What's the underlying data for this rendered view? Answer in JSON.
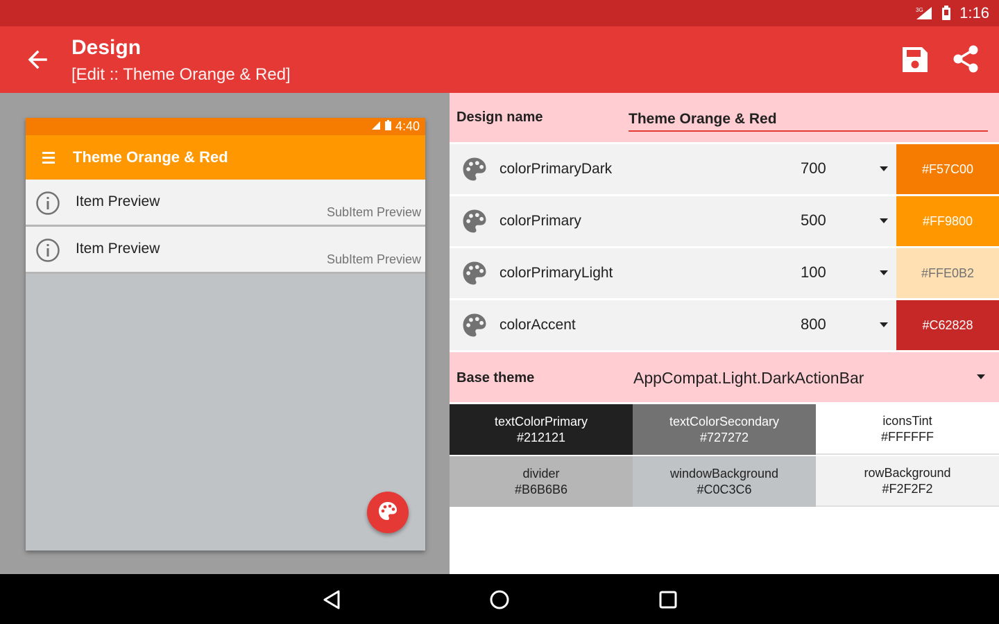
{
  "status_bar": {
    "time": "1:16",
    "network": "3G"
  },
  "app_bar": {
    "title": "Design",
    "subtitle": "[Edit :: Theme Orange & Red]"
  },
  "preview": {
    "status_time": "4:40",
    "toolbar_title": "Theme Orange & Red",
    "items": [
      {
        "title": "Item Preview",
        "subtitle": "SubItem Preview"
      },
      {
        "title": "Item Preview",
        "subtitle": "SubItem Preview"
      }
    ]
  },
  "design": {
    "name_label": "Design name",
    "name_value": "Theme Orange & Red"
  },
  "colors": [
    {
      "name": "colorPrimaryDark",
      "shade": "700",
      "hex": "#F57C00",
      "swatch_color": "#F57C00",
      "text_color": "#FFFFFF"
    },
    {
      "name": "colorPrimary",
      "shade": "500",
      "hex": "#FF9800",
      "swatch_color": "#FF9800",
      "text_color": "#FFFFFF"
    },
    {
      "name": "colorPrimaryLight",
      "shade": "100",
      "hex": "#FFE0B2",
      "swatch_color": "#FFE0B2",
      "text_color": "#727272"
    },
    {
      "name": "colorAccent",
      "shade": "800",
      "hex": "#C62828",
      "swatch_color": "#C62828",
      "text_color": "#FFFFFF"
    }
  ],
  "base_theme": {
    "label": "Base theme",
    "value": "AppCompat.Light.DarkActionBar"
  },
  "tiles": [
    {
      "name": "textColorPrimary",
      "hex": "#212121",
      "bg": "#212121",
      "fg": "#FFFFFF"
    },
    {
      "name": "textColorSecondary",
      "hex": "#727272",
      "bg": "#727272",
      "fg": "#FFFFFF"
    },
    {
      "name": "iconsTint",
      "hex": "#FFFFFF",
      "bg": "#FFFFFF",
      "fg": "#212121"
    },
    {
      "name": "divider",
      "hex": "#B6B6B6",
      "bg": "#B6B6B6",
      "fg": "#212121"
    },
    {
      "name": "windowBackground",
      "hex": "#C0C3C6",
      "bg": "#C0C3C6",
      "fg": "#212121"
    },
    {
      "name": "rowBackground",
      "hex": "#F2F2F2",
      "bg": "#F2F2F2",
      "fg": "#212121"
    }
  ]
}
